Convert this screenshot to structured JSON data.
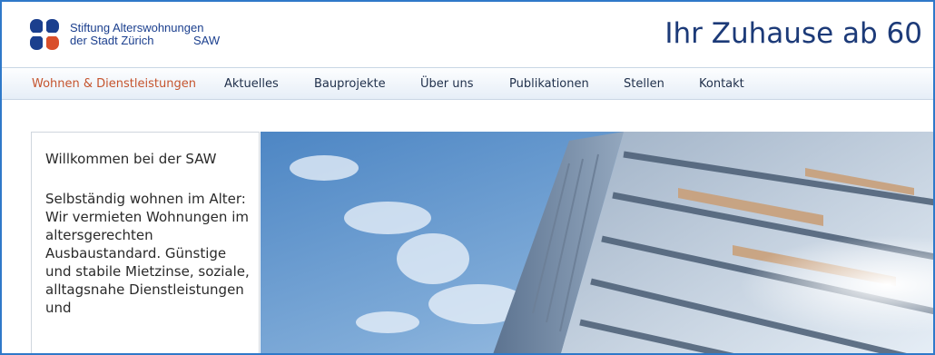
{
  "header": {
    "logo": {
      "line1": "Stiftung Alterswohnungen",
      "line2": "der Stadt Zürich",
      "abbr": "SAW"
    },
    "tagline": "Ihr Zuhause ab 60"
  },
  "nav": {
    "items": [
      {
        "label": "Wohnen & Dienstleistungen",
        "active": true
      },
      {
        "label": "Aktuelles",
        "active": false
      },
      {
        "label": "Bauprojekte",
        "active": false
      },
      {
        "label": "Über uns",
        "active": false
      },
      {
        "label": "Publikationen",
        "active": false
      },
      {
        "label": "Stellen",
        "active": false
      },
      {
        "label": "Kontakt",
        "active": false
      }
    ]
  },
  "intro": {
    "title": "Willkommen bei der SAW",
    "body": "Selbständig wohnen im Alter: Wir vermieten Wohnungen im altersgerechten Ausbaustandard. Günstige und stabile Mietzinse, soziale, alltagsnahe Dienstleistungen und"
  },
  "colors": {
    "frame_border": "#2f79c9",
    "brand_blue": "#1b3f8e",
    "nav_active": "#c5542e",
    "logo_accent": "#d94f2b"
  },
  "hero": {
    "icon": "building-photo"
  }
}
